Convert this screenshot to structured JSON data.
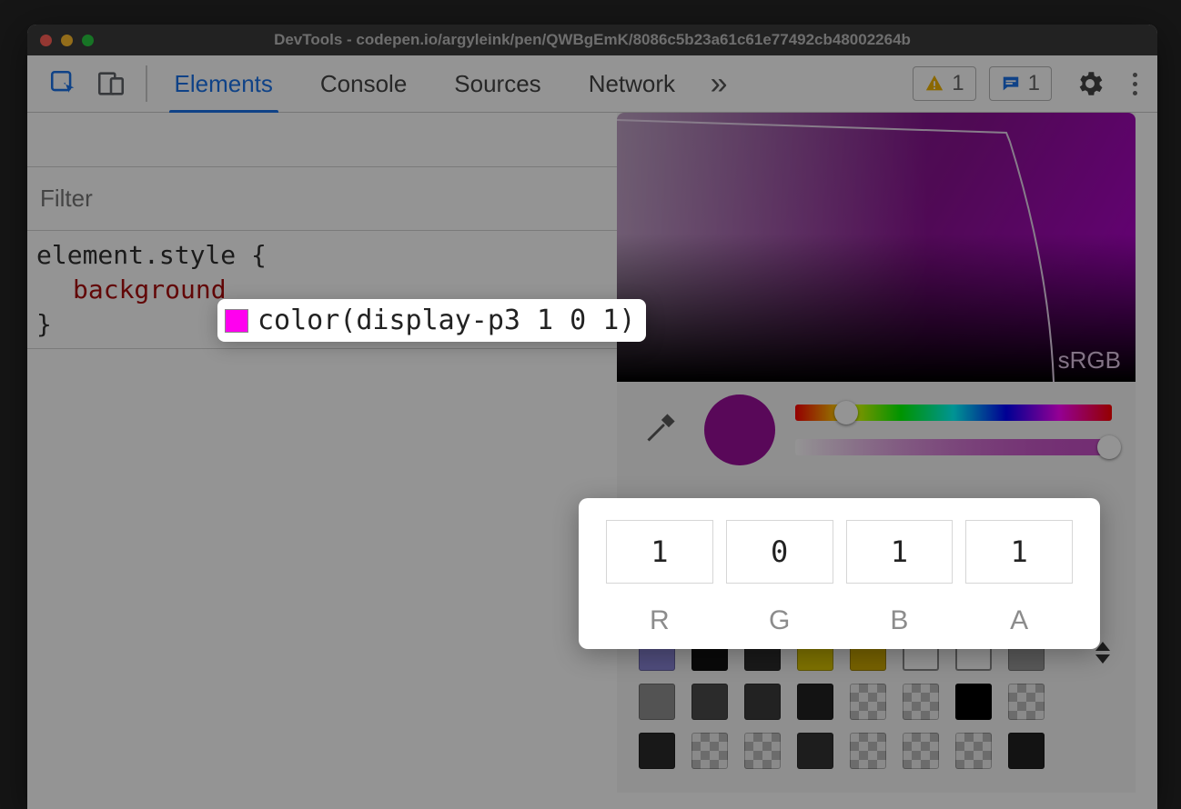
{
  "window": {
    "title": "DevTools - codepen.io/argyleink/pen/QWBgEmK/8086c5b23a61c61e77492cb48002264b"
  },
  "toolbar": {
    "tabs": [
      "Elements",
      "Console",
      "Sources",
      "Network"
    ],
    "active_tab_index": 0,
    "warnings_count": "1",
    "messages_count": "1"
  },
  "styles": {
    "filter_placeholder": "Filter",
    "selector": "element.style {",
    "property_name": "background",
    "close_brace": "}"
  },
  "color_tooltip": {
    "value": "color(display-p3 1 0 1)",
    "swatch_hex": "#ff00ef"
  },
  "picker": {
    "gamut_label": "sRGB",
    "preview_hex": "#9a0f9a",
    "channels": {
      "R": "1",
      "G": "0",
      "B": "1",
      "A": "1"
    },
    "hue_thumb_pct": 16,
    "alpha_thumb_pct": 99,
    "palette_rows": [
      [
        "#8a85d7",
        "#111111",
        "#2b2b2b",
        "#d9c400",
        "#cda900",
        "outline",
        "outline",
        "#9a9a9a"
      ],
      [
        "#8f8f8f",
        "#4a4a4a",
        "#3b3b3b",
        "#222222",
        "checker",
        "checker",
        "#000000",
        "checker"
      ],
      [
        "#2a2a2a",
        "checker",
        "checker",
        "#333333",
        "checker",
        "checker",
        "checker",
        "#222222"
      ]
    ]
  }
}
